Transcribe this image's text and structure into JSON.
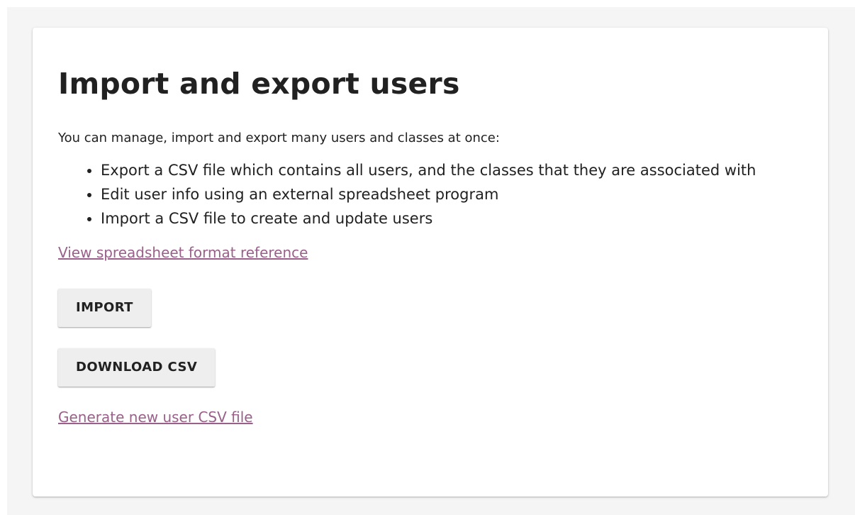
{
  "page": {
    "title": "Import and export users",
    "intro": "You can manage, import and export many users and classes at once:",
    "bullets": [
      "Export a CSV file which contains all users, and the classes that they are associated with",
      "Edit user info using an external spreadsheet program",
      "Import a CSV file to create and update users"
    ],
    "reference_link": "View spreadsheet format reference",
    "import_button": "IMPORT",
    "download_button": "DOWNLOAD CSV",
    "generate_link": "Generate new user CSV file"
  },
  "colors": {
    "link": "#996189",
    "button_bg": "#eeeeee",
    "page_bg": "#f5f5f5"
  }
}
